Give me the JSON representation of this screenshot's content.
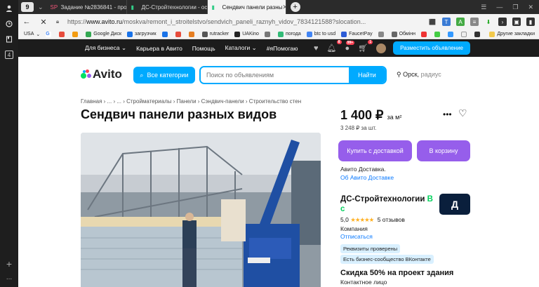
{
  "sidebar": {
    "profile_icon": "person-icon",
    "history_icon": "clock-icon",
    "collections_icon": "bookmark-icon",
    "tab_count": "4",
    "add_icon": "plus-icon",
    "more": "..."
  },
  "tabs": [
    {
      "favicon": "SP",
      "label": "Задание №2836841 - про"
    },
    {
      "favicon": "▮",
      "label": "ДС-Стройтехнологии - ос"
    },
    {
      "favicon": "▮",
      "label": "Сендвич панели разны"
    }
  ],
  "tabbar": {
    "tab_count_badge": "9",
    "new_tab": "+"
  },
  "address": {
    "scheme": "https://",
    "domain": "www.avito.ru",
    "path": "/moskva/remont_i_stroitelstvo/sendvich_paneli_raznyh_vidov_7834121588?slocation..."
  },
  "bookmarks": [
    "USA",
    "G",
    "",
    "",
    "Google Диск",
    "загрузчик",
    "",
    "",
    "",
    "rutracker",
    "UAKino",
    "",
    "погода",
    "btc to usd",
    "FaucetPay",
    "",
    "Обмінн",
    "",
    "",
    "",
    "",
    "",
    "Другие закладки"
  ],
  "topnav": {
    "items": [
      "Для бизнеса",
      "Карьера в Авито",
      "Помощь",
      "Каталоги",
      "#яПомогаю"
    ],
    "badge_notifications": "8",
    "badge_messages": "99+",
    "badge_cart": "1",
    "post_button": "Разместить объявление"
  },
  "header": {
    "logo": "Avito",
    "categories_button": "Все категории",
    "search_placeholder": "Поиск по объявлениям",
    "search_button": "Найти",
    "location": "Орск,",
    "location_radius": "радиус"
  },
  "breadcrumbs": "Главная › ... › ... › Стройматериалы › Панели › Сэндвич-панели › Строительство стен",
  "listing": {
    "title": "Сендвич панели разных видов",
    "price": "1 400 ₽",
    "price_unit": "за м²",
    "price_per_piece": "3 248 ₽ за шт.",
    "buy_button": "Купить с доставкой",
    "cart_button": "В корзину",
    "delivery": "Авито Доставка.",
    "delivery_link": "Об Авито Доставке"
  },
  "seller": {
    "name": "ДС-Стройтехнологии",
    "since": "В с",
    "logo": "Д",
    "rating": "5,0",
    "stars": "★★★★★",
    "reviews": "5 отзывов",
    "type": "Компания",
    "unsubscribe": "Отписаться",
    "tag_verified": "Реквизиты проверены",
    "tag_vk": "Есть бизнес-сообщество ВКонтакте",
    "promo": "Скидка 50% на проект здания",
    "contact": "Контактное лицо"
  },
  "colors": {
    "avito_blue": "#00aaff",
    "purple": "#965eeb",
    "topnav_bg": "#1c1c1c"
  }
}
